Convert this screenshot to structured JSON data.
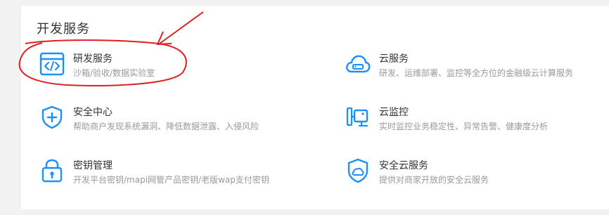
{
  "section": {
    "title": "开发服务"
  },
  "services": [
    {
      "name": "研发服务",
      "desc": "沙箱/验收/数据实验室",
      "icon": "code-window-icon"
    },
    {
      "name": "云服务",
      "desc": "研发、运维部署、监控等全方位的金融级云计算服务",
      "icon": "cloud-server-icon"
    },
    {
      "name": "安全中心",
      "desc": "帮助商户发现系统漏洞、降低数据泄露、入侵风险",
      "icon": "shield-plus-icon"
    },
    {
      "name": "云监控",
      "desc": "实时监控业务稳定性、异常告警、健康度分析",
      "icon": "monitor-camera-icon"
    },
    {
      "name": "密钥管理",
      "desc": "开发平台密钥/mapi网管产品密钥/老版wap支付密钥",
      "icon": "lock-icon"
    },
    {
      "name": "安全云服务",
      "desc": "提供对商家开放的安全云服务",
      "icon": "shield-cloud-icon"
    }
  ],
  "colors": {
    "accent": "#1890ff",
    "annotation": "#e02020",
    "title": "#333333",
    "desc": "#999999"
  }
}
